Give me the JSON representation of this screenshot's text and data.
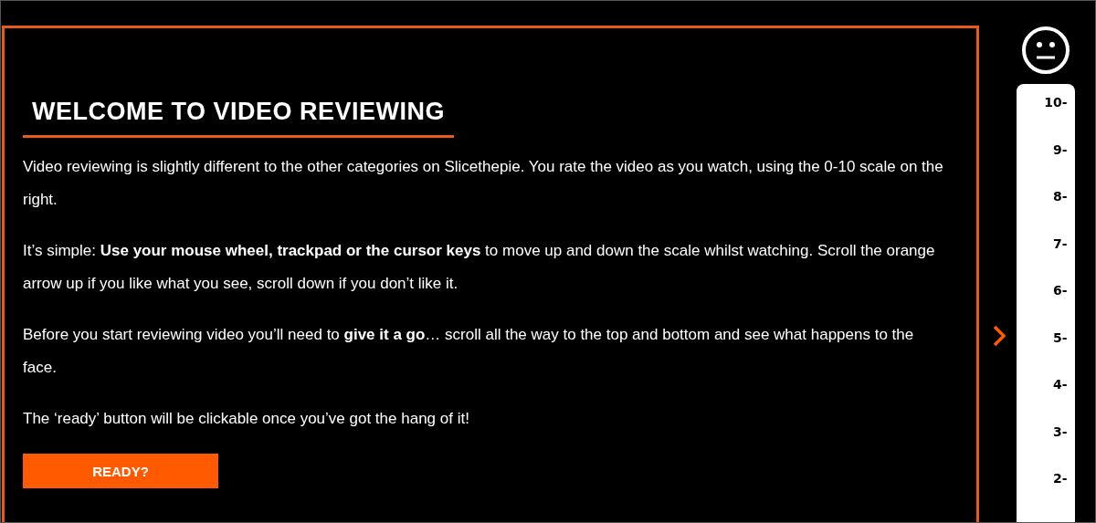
{
  "heading": "WELCOME TO VIDEO REVIEWING",
  "paragraphs": [
    "Video reviewing is slightly different to the other categories on Slicethepie. You rate the video as you watch, using the 0-10 scale on the right.",
    "It’s simple: **Use your mouse wheel, trackpad or the cursor keys** to move up and down the scale whilst watching. Scroll the orange arrow up if you like what you see, scroll down if you don’t like it.",
    "Before you start reviewing video you’ll need to **give it a go**… scroll all the way to the top and bottom and see what happens to the face.",
    "The ‘ready’ button will be clickable once you’ve got the hang of it!"
  ],
  "ready_button": "READY?",
  "scale": [
    {
      "label": "10-",
      "selected": false
    },
    {
      "label": "9-",
      "selected": false
    },
    {
      "label": "8-",
      "selected": false
    },
    {
      "label": "7-",
      "selected": false
    },
    {
      "label": "6-",
      "selected": false
    },
    {
      "label": "5-",
      "selected": true
    },
    {
      "label": "4-",
      "selected": false
    },
    {
      "label": "3-",
      "selected": false
    },
    {
      "label": "2-",
      "selected": false
    }
  ]
}
